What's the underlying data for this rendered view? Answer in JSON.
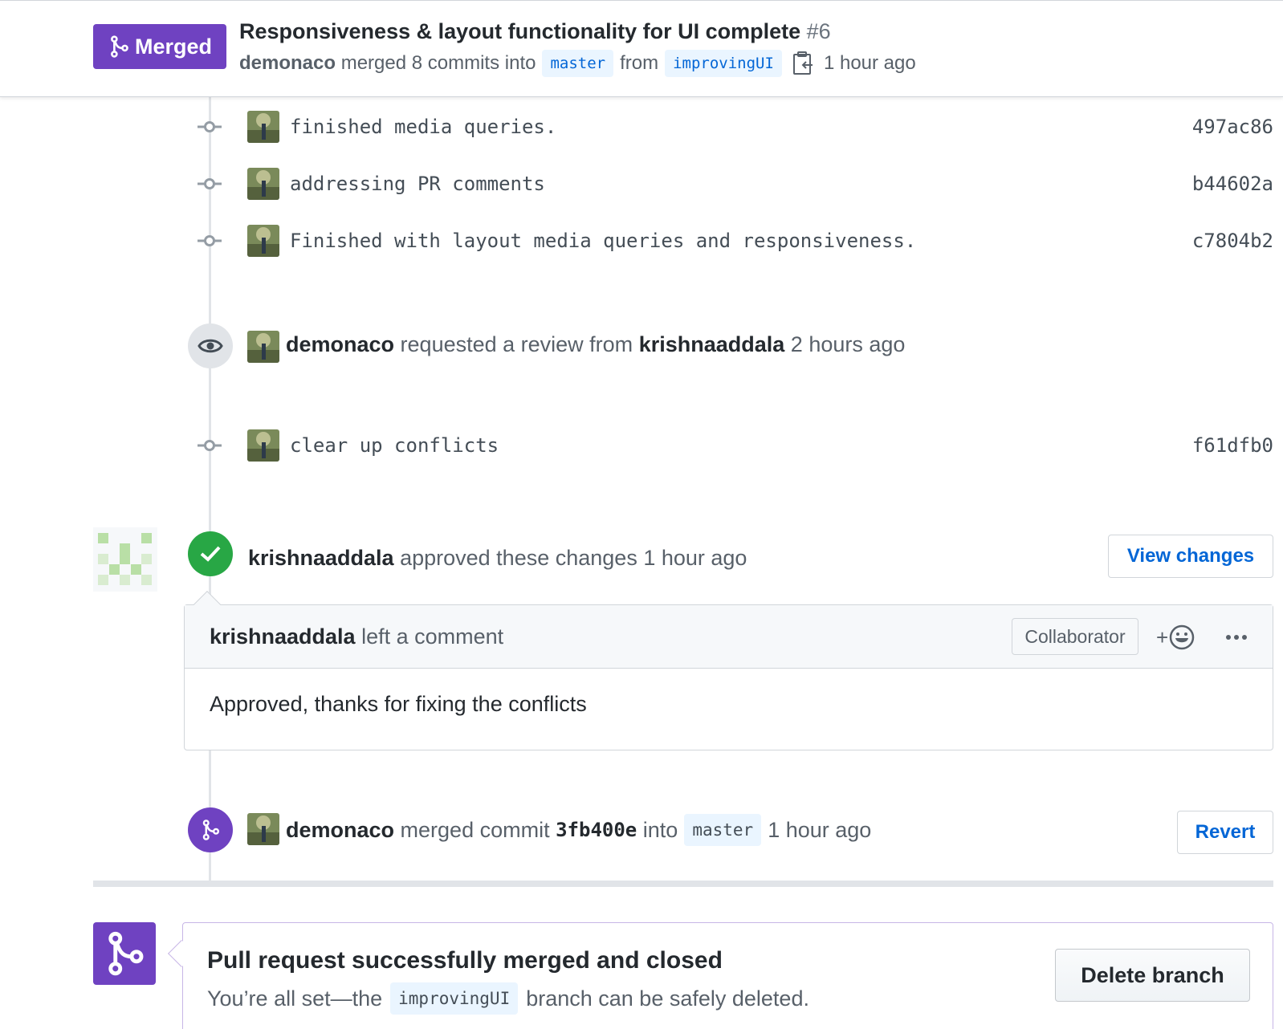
{
  "header": {
    "badge_label": "Merged",
    "title": "Responsiveness & layout functionality for UI complete",
    "number": "#6",
    "author": "demonaco",
    "merged_text": "merged 8 commits into",
    "base_branch": "master",
    "from_text": "from",
    "head_branch": "improvingUI",
    "time": "1 hour ago"
  },
  "commits_top": [
    {
      "message": "finished media queries.",
      "sha": "497ac86"
    },
    {
      "message": "addressing PR comments",
      "sha": "b44602a"
    },
    {
      "message": "Finished with layout media queries and responsiveness.",
      "sha": "c7804b2"
    }
  ],
  "review_request": {
    "actor": "demonaco",
    "text": "requested a review from",
    "reviewer": "krishnaaddala",
    "time": "2 hours ago"
  },
  "commit_conflicts": {
    "message": "clear up conflicts",
    "sha": "f61dfb0"
  },
  "approval": {
    "actor": "krishnaaddala",
    "text": "approved these changes",
    "time": "1 hour ago",
    "button": "View changes"
  },
  "comment": {
    "author": "krishnaaddala",
    "action": "left a comment",
    "role": "Collaborator",
    "reaction_plus": "+",
    "body": "Approved, thanks for fixing the conflicts"
  },
  "merge_event": {
    "actor": "demonaco",
    "text": "merged commit",
    "commit": "3fb400e",
    "into": "into",
    "branch": "master",
    "time": "1 hour ago",
    "button": "Revert"
  },
  "merge_panel": {
    "title": "Pull request successfully merged and closed",
    "sub_before": "You’re all set—the",
    "branch": "improvingUI",
    "sub_after": "branch can be safely deleted.",
    "button": "Delete branch"
  },
  "colors": {
    "merged": "#6f42c1",
    "approved": "#28a745",
    "link": "#0366d6"
  }
}
